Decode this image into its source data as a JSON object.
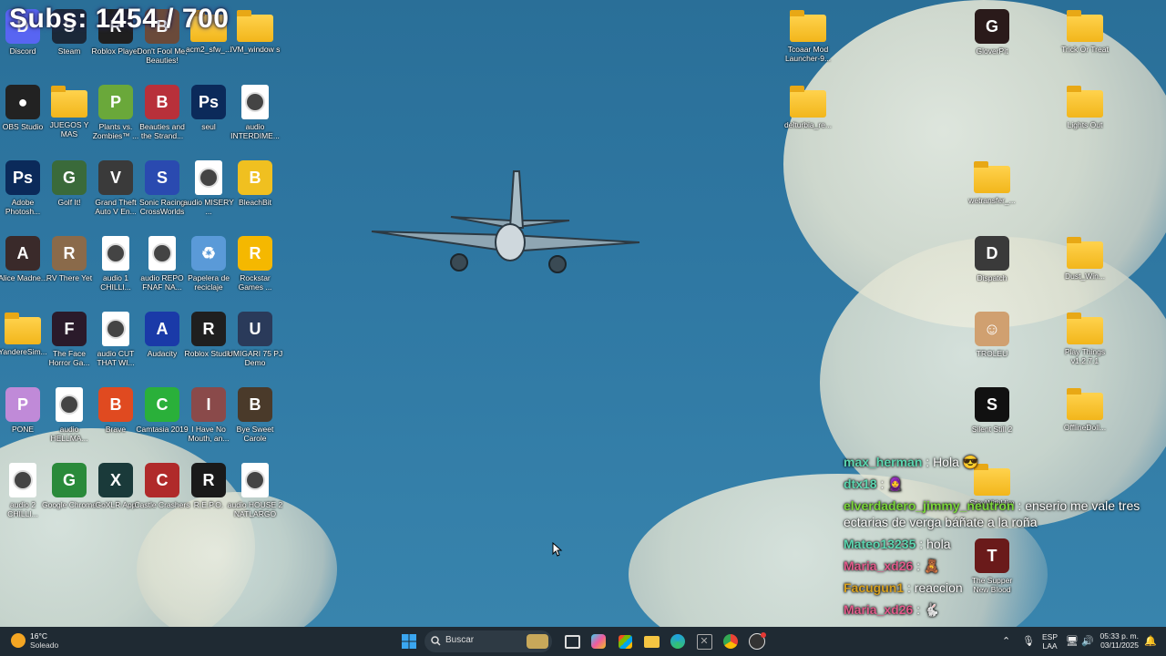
{
  "overlay": {
    "subs": "Subs: 1454 / 700"
  },
  "desktop_icons_left": [
    {
      "label": "Discord",
      "type": "app",
      "color": "#5865f2",
      "glyph": "D"
    },
    {
      "label": "Steam",
      "type": "app",
      "color": "#1b2838",
      "glyph": "S"
    },
    {
      "label": "Roblox Player",
      "type": "app",
      "color": "#1f1f1f",
      "glyph": "R"
    },
    {
      "label": "Don't Fool Me, Beauties!",
      "type": "app",
      "color": "#6a4a3a",
      "glyph": "B"
    },
    {
      "label": "acm2_sfw_...",
      "type": "folder"
    },
    {
      "label": "IVM_window s",
      "type": "folder"
    },
    {
      "label": "OBS Studio",
      "type": "app",
      "color": "#222",
      "glyph": "●"
    },
    {
      "label": "JUEGOS Y MAS",
      "type": "folder"
    },
    {
      "label": "Plants vs. Zombies™ ...",
      "type": "app",
      "color": "#6aa83a",
      "glyph": "P"
    },
    {
      "label": "Beauties and the Strand...",
      "type": "app",
      "color": "#b8303a",
      "glyph": "B"
    },
    {
      "label": "seul",
      "type": "app",
      "color": "#0b2a5a",
      "glyph": "Ps"
    },
    {
      "label": "audio INTERDIME...",
      "type": "file"
    },
    {
      "label": "Adobe Photosh...",
      "type": "app",
      "color": "#0b2a5a",
      "glyph": "Ps"
    },
    {
      "label": "Golf It!",
      "type": "app",
      "color": "#3a6a3a",
      "glyph": "G"
    },
    {
      "label": "Grand Theft Auto V En...",
      "type": "app",
      "color": "#3a3a3a",
      "glyph": "V"
    },
    {
      "label": "Sonic Racing CrossWorlds",
      "type": "app",
      "color": "#2a4ab0",
      "glyph": "S"
    },
    {
      "label": "audio MISERY ...",
      "type": "file"
    },
    {
      "label": "BleachBit",
      "type": "app",
      "color": "#f0c020",
      "glyph": "B"
    },
    {
      "label": "Alice Madne...",
      "type": "app",
      "color": "#3a2a2a",
      "glyph": "A"
    },
    {
      "label": "RV There Yet",
      "type": "app",
      "color": "#8a6a4a",
      "glyph": "R"
    },
    {
      "label": "audio 1 CHILLI...",
      "type": "file"
    },
    {
      "label": "audio REPO FNAF NA...",
      "type": "file"
    },
    {
      "label": "Papelera de reciclaje",
      "type": "app",
      "color": "#5a9ad8",
      "glyph": "♻"
    },
    {
      "label": "Rockstar Games ...",
      "type": "app",
      "color": "#f5b800",
      "glyph": "R"
    },
    {
      "label": "YandereSim...",
      "type": "folder"
    },
    {
      "label": "The Face Horror Ga...",
      "type": "app",
      "color": "#2a1a2a",
      "glyph": "F"
    },
    {
      "label": "audio CUT THAT WI...",
      "type": "file"
    },
    {
      "label": "Audacity",
      "type": "app",
      "color": "#1a3aa8",
      "glyph": "A"
    },
    {
      "label": "Roblox Studio",
      "type": "app",
      "color": "#1f1f1f",
      "glyph": "R"
    },
    {
      "label": "UMIGARI 75 PJ Demo",
      "type": "app",
      "color": "#2a3a5a",
      "glyph": "U"
    },
    {
      "label": "PONE",
      "type": "app",
      "color": "#c08ad8",
      "glyph": "P"
    },
    {
      "label": "audio HELLMA...",
      "type": "file"
    },
    {
      "label": "Brave",
      "type": "app",
      "color": "#e04a20",
      "glyph": "B"
    },
    {
      "label": "Camtasia 2019",
      "type": "app",
      "color": "#2ab03a",
      "glyph": "C"
    },
    {
      "label": "I Have No Mouth, an...",
      "type": "app",
      "color": "#8a4a4a",
      "glyph": "I"
    },
    {
      "label": "Bye Sweet Carole",
      "type": "app",
      "color": "#4a3a2a",
      "glyph": "B"
    },
    {
      "label": "audio 2 CHILLI...",
      "type": "file"
    },
    {
      "label": "Google Chrome",
      "type": "app",
      "color": "#2a8a3a",
      "glyph": "G"
    },
    {
      "label": "GoXLR App",
      "type": "app",
      "color": "#1a3a3a",
      "glyph": "X"
    },
    {
      "label": "Castle Crashers",
      "type": "app",
      "color": "#b02a2a",
      "glyph": "C"
    },
    {
      "label": "R.E.P.O.",
      "type": "app",
      "color": "#1a1a1a",
      "glyph": "R"
    },
    {
      "label": "audio HOUSE 2 NATLARGO",
      "type": "file"
    }
  ],
  "desktop_icons_right": [
    {
      "label": "Tcoaar Mod Launcher-9...",
      "type": "folder"
    },
    {
      "label": "GloverPit",
      "type": "app",
      "color": "#2a1a1a",
      "glyph": "G"
    },
    {
      "label": "Trick Or Treat",
      "type": "folder"
    },
    {
      "label": "delturbia_re...",
      "type": "folder"
    },
    {
      "label": "Lights Out",
      "type": "folder"
    },
    {
      "label": "wetransfer_...",
      "type": "folder"
    },
    {
      "label": "Dispatch",
      "type": "app",
      "color": "#3a3a3a",
      "glyph": "D"
    },
    {
      "label": "Dust_Win...",
      "type": "folder"
    },
    {
      "label": "TROLEU",
      "type": "app",
      "color": "#d0a070",
      "glyph": "☺"
    },
    {
      "label": "Play Things v1.2.7.1",
      "type": "folder"
    },
    {
      "label": "Silent Still 2",
      "type": "app",
      "color": "#111",
      "glyph": "S"
    },
    {
      "label": "OfflineDoll...",
      "type": "folder"
    },
    {
      "label": "StayWithHim",
      "type": "folder"
    },
    {
      "label": "The Supper New Blood",
      "type": "app",
      "color": "#6a1a1a",
      "glyph": "T"
    }
  ],
  "chat": [
    {
      "user": "max_herman",
      "text": "Hola 😎",
      "color": "#5cd6b0"
    },
    {
      "user": "dtx18",
      "text": "🧕",
      "color": "#5cd6b0"
    },
    {
      "user": "elverdadero_jimmy_neutron",
      "text": "enserio me vale tres ectarias de verga báñate a la roña",
      "color": "#7ad63a"
    },
    {
      "user": "Mateo13235",
      "text": "hola",
      "color": "#5cd6b0"
    },
    {
      "user": "Maria_xd26",
      "text": "🧸",
      "color": "#e05a8a"
    },
    {
      "user": "Facugun1",
      "text": "reaccion",
      "color": "#d6a020"
    },
    {
      "user": "Maria_xd26",
      "text": "🐇",
      "color": "#e05a8a"
    }
  ],
  "taskbar": {
    "weather_temp": "16°C",
    "weather_desc": "Soleado",
    "search_placeholder": "Buscar",
    "lang_top": "ESP",
    "lang_bottom": "LAA",
    "time": "05:33 p. m.",
    "date": "03/11/2025"
  }
}
